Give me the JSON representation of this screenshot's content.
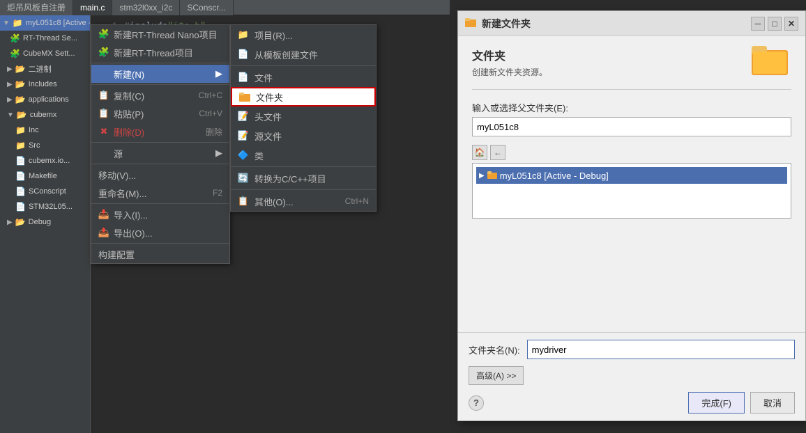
{
  "tabs": [
    {
      "label": "炬吊风板自注册",
      "active": false
    },
    {
      "label": "main.c",
      "active": false
    },
    {
      "label": "stm32l0xx_i2c",
      "active": false
    },
    {
      "label": "SConscr...",
      "active": false
    }
  ],
  "code": {
    "line1": "#include \"i2c.h\""
  },
  "sidebar": {
    "title": "myL051c8",
    "items": [
      {
        "label": "myL051c8 [Active - Debug]",
        "level": 0,
        "arrow": "▼",
        "icon": "project"
      },
      {
        "label": "RT-Thread Se...",
        "level": 1,
        "arrow": "",
        "icon": "folder"
      },
      {
        "label": "CubeMX Sett...",
        "level": 1,
        "arrow": "",
        "icon": "folder"
      },
      {
        "label": "二进制",
        "level": 1,
        "arrow": "▶",
        "icon": "folder"
      },
      {
        "label": "Includes",
        "level": 1,
        "arrow": "▶",
        "icon": "folder"
      },
      {
        "label": "applications",
        "level": 1,
        "arrow": "▶",
        "icon": "folder"
      },
      {
        "label": "cubemx",
        "level": 1,
        "arrow": "▼",
        "icon": "folder"
      },
      {
        "label": "Inc",
        "level": 2,
        "arrow": "",
        "icon": "folder"
      },
      {
        "label": "Src",
        "level": 2,
        "arrow": "",
        "icon": "folder"
      },
      {
        "label": "cubemx.io...",
        "level": 2,
        "arrow": "",
        "icon": "file"
      },
      {
        "label": "Makefile",
        "level": 2,
        "arrow": "",
        "icon": "file"
      },
      {
        "label": "SConscript",
        "level": 2,
        "arrow": "",
        "icon": "file"
      },
      {
        "label": "STM32L05...",
        "level": 2,
        "arrow": "",
        "icon": "file"
      },
      {
        "label": "Debug",
        "level": 1,
        "arrow": "▶",
        "icon": "folder"
      }
    ]
  },
  "context_menu": {
    "items": [
      {
        "label": "新建RT-Thread Nano项目",
        "shortcut": "",
        "submenu": false,
        "icon": "rt-nano"
      },
      {
        "label": "新建RT-Thread项目",
        "shortcut": "",
        "submenu": false,
        "icon": "rt"
      },
      {
        "label": "新建(N)",
        "shortcut": "",
        "submenu": true,
        "icon": "",
        "highlighted": true
      },
      {
        "label": "复制(C)",
        "shortcut": "Ctrl+C",
        "submenu": false,
        "icon": "copy"
      },
      {
        "label": "粘贴(P)",
        "shortcut": "Ctrl+V",
        "submenu": false,
        "icon": "paste"
      },
      {
        "label": "删除(D)",
        "shortcut": "删除",
        "submenu": false,
        "icon": "delete",
        "isDelete": true
      },
      {
        "label": "源",
        "shortcut": "",
        "submenu": true,
        "icon": ""
      },
      {
        "label": "移动(V)...",
        "shortcut": "",
        "submenu": false,
        "icon": ""
      },
      {
        "label": "重命名(M)...",
        "shortcut": "F2",
        "submenu": false,
        "icon": ""
      },
      {
        "label": "导入(I)...",
        "shortcut": "",
        "submenu": false,
        "icon": "import"
      },
      {
        "label": "导出(O)...",
        "shortcut": "",
        "submenu": false,
        "icon": "export"
      },
      {
        "label": "构建配置",
        "shortcut": "",
        "submenu": false,
        "icon": ""
      }
    ]
  },
  "submenu": {
    "items": [
      {
        "label": "项目(R)...",
        "icon": "project"
      },
      {
        "label": "从模板创建文件",
        "icon": "template"
      },
      {
        "label": "文件",
        "icon": "file"
      },
      {
        "label": "文件夹",
        "icon": "folder",
        "highlighted": true
      },
      {
        "label": "头文件",
        "icon": "header"
      },
      {
        "label": "源文件",
        "icon": "source"
      },
      {
        "label": "类",
        "icon": "class"
      },
      {
        "label": "转换为C/C++项目",
        "icon": "convert"
      },
      {
        "label": "其他(O)...",
        "shortcut": "Ctrl+N",
        "icon": "other"
      }
    ]
  },
  "dialog": {
    "title": "新建文件夹",
    "section_title": "文件夹",
    "section_desc": "创建新文件夹资源。",
    "parent_label": "输入或选择父文件夹(E):",
    "parent_value": "myL051c8",
    "tree_items": [
      {
        "label": "myL051c8  [Active - Debug]",
        "selected": true
      }
    ],
    "filename_label": "文件夹名(N):",
    "filename_value": "mydriver",
    "advanced_btn": "高级(A) >>",
    "help_btn": "?",
    "finish_btn": "完成(F)",
    "cancel_btn": "取消"
  },
  "colors": {
    "accent": "#4b6eaf",
    "delete_red": "#cc4444",
    "highlight_border": "#cc0000"
  }
}
